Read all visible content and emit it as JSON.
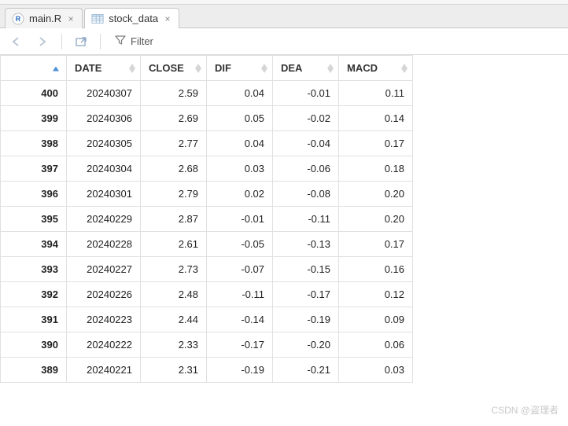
{
  "tabs": [
    {
      "label": "main.R",
      "active": false,
      "icon": "r-file-icon"
    },
    {
      "label": "stock_data",
      "active": true,
      "icon": "data-frame-icon"
    }
  ],
  "toolbar": {
    "filter_label": "Filter"
  },
  "table": {
    "columns": [
      "DATE",
      "CLOSE",
      "DIF",
      "DEA",
      "MACD"
    ],
    "rows": [
      {
        "n": "400",
        "DATE": "20240307",
        "CLOSE": "2.59",
        "DIF": "0.04",
        "DEA": "-0.01",
        "MACD": "0.11"
      },
      {
        "n": "399",
        "DATE": "20240306",
        "CLOSE": "2.69",
        "DIF": "0.05",
        "DEA": "-0.02",
        "MACD": "0.14"
      },
      {
        "n": "398",
        "DATE": "20240305",
        "CLOSE": "2.77",
        "DIF": "0.04",
        "DEA": "-0.04",
        "MACD": "0.17"
      },
      {
        "n": "397",
        "DATE": "20240304",
        "CLOSE": "2.68",
        "DIF": "0.03",
        "DEA": "-0.06",
        "MACD": "0.18"
      },
      {
        "n": "396",
        "DATE": "20240301",
        "CLOSE": "2.79",
        "DIF": "0.02",
        "DEA": "-0.08",
        "MACD": "0.20"
      },
      {
        "n": "395",
        "DATE": "20240229",
        "CLOSE": "2.87",
        "DIF": "-0.01",
        "DEA": "-0.11",
        "MACD": "0.20"
      },
      {
        "n": "394",
        "DATE": "20240228",
        "CLOSE": "2.61",
        "DIF": "-0.05",
        "DEA": "-0.13",
        "MACD": "0.17"
      },
      {
        "n": "393",
        "DATE": "20240227",
        "CLOSE": "2.73",
        "DIF": "-0.07",
        "DEA": "-0.15",
        "MACD": "0.16"
      },
      {
        "n": "392",
        "DATE": "20240226",
        "CLOSE": "2.48",
        "DIF": "-0.11",
        "DEA": "-0.17",
        "MACD": "0.12"
      },
      {
        "n": "391",
        "DATE": "20240223",
        "CLOSE": "2.44",
        "DIF": "-0.14",
        "DEA": "-0.19",
        "MACD": "0.09"
      },
      {
        "n": "390",
        "DATE": "20240222",
        "CLOSE": "2.33",
        "DIF": "-0.17",
        "DEA": "-0.20",
        "MACD": "0.06"
      },
      {
        "n": "389",
        "DATE": "20240221",
        "CLOSE": "2.31",
        "DIF": "-0.19",
        "DEA": "-0.21",
        "MACD": "0.03"
      }
    ]
  },
  "watermark": "CSDN @盗理者"
}
